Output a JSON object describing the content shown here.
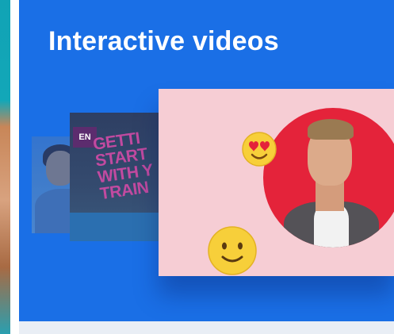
{
  "main": {
    "title": "Interactive videos"
  },
  "thumbnails": {
    "training_logo": "EN",
    "training_banner": "GETTI\nSTART\nWITH Y\nTRAIN"
  },
  "icons": {
    "love": "heart-eyes-emoji-icon",
    "smile": "smiley-emoji-icon"
  },
  "colors": {
    "card_background": "#1a6fe6",
    "panel_pink": "#f6cdd4",
    "circle_red": "#e4233a",
    "emoji_yellow": "#f7cf3a"
  }
}
